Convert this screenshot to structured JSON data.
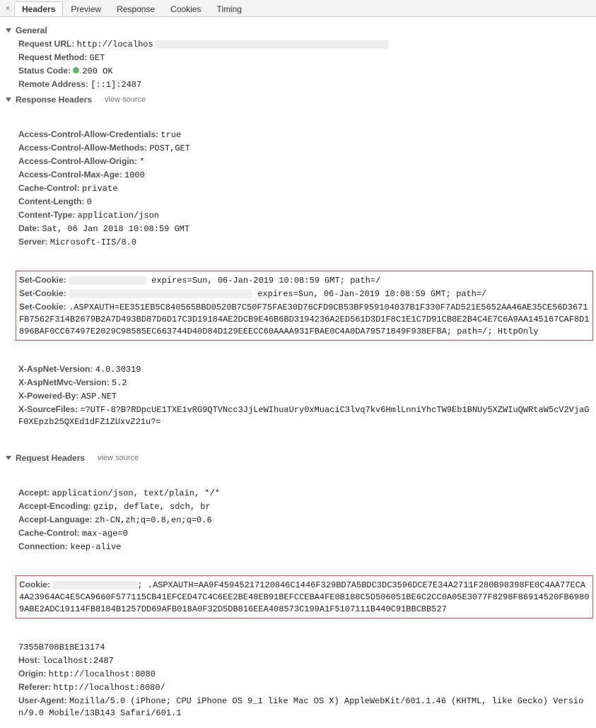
{
  "tabs": {
    "items": [
      "Headers",
      "Preview",
      "Response",
      "Cookies",
      "Timing"
    ],
    "active": 0
  },
  "sections": {
    "general": {
      "title": "General",
      "rows": [
        {
          "key": "Request URL:",
          "val": "http://localhos",
          "blur_after_w": 330
        },
        {
          "key": "Request Method:",
          "val": "GET"
        },
        {
          "key": "Status Code:",
          "val": "200 OK",
          "status_dot": true
        },
        {
          "key": "Remote Address:",
          "val": "[::1]:2487"
        }
      ]
    },
    "response": {
      "title": "Response Headers",
      "view_source": "view source",
      "rows": [
        {
          "key": "Access-Control-Allow-Credentials:",
          "val": "true"
        },
        {
          "key": "Access-Control-Allow-Methods:",
          "val": "POST,GET"
        },
        {
          "key": "Access-Control-Allow-Origin:",
          "val": "*"
        },
        {
          "key": "Access-Control-Max-Age:",
          "val": "1000"
        },
        {
          "key": "Cache-Control:",
          "val": "private"
        },
        {
          "key": "Content-Length:",
          "val": "0"
        },
        {
          "key": "Content-Type:",
          "val": "application/json"
        },
        {
          "key": "Date:",
          "val": "Sat, 06 Jan 2018 10:08:59 GMT"
        },
        {
          "key": "Server:",
          "val": "Microsoft-IIS/8.0"
        }
      ],
      "red_rows": [
        {
          "key": "Set-Cookie:",
          "pre_blur_w": 110,
          "val": " expires=Sun, 06-Jan-2019 10:08:59 GMT; path=/"
        },
        {
          "key": "Set-Cookie:",
          "pre_blur_w": 260,
          "val": " expires=Sun, 06-Jan-2019 10:08:59 GMT; path=/"
        },
        {
          "key": "Set-Cookie:",
          "val": ".ASPXAUTH=EE351EB5C840565BBD0520B7C50F75FAE30D76CFD9CB53BF959104037B1F330F7AD521E5652AA46AE35CE56D3671FB7562F314B2679B2A7D493BD87D6D17C3D19184AE2DCB9E46B6BD3194236A2ED561D3D1F8C1E1C7D91CB8E2B4C4E7C6A9AA145167CAF8D1896BAF0CC67497E2029C98585EC663744D40D84D129EEECC60AAAA931FBAE0C4A0DA79571849F938EFBA; path=/; HttpOnly"
        }
      ],
      "rows_after": [
        {
          "key": "X-AspNet-Version:",
          "val": "4.0.30319"
        },
        {
          "key": "X-AspNetMvc-Version:",
          "val": "5.2"
        },
        {
          "key": "X-Powered-By:",
          "val": "ASP.NET"
        },
        {
          "key": "X-SourceFiles:",
          "val": "=?UTF-8?B?RDpcUE1TXE1vRG9QTVNcc3JjLeWIhuaUry0xMuaciC3lvq7kv6HmlLnniYhcTW9Eb1BNUy5XZWIuQWRtaW5cV2VjaGF0XEpzb25QXEd1dFZ1ZUxvZ21u?="
        }
      ]
    },
    "request": {
      "title": "Request Headers",
      "view_source": "view source",
      "rows": [
        {
          "key": "Accept:",
          "val": "application/json, text/plain, */*"
        },
        {
          "key": "Accept-Encoding:",
          "val": "gzip, deflate, sdch, br"
        },
        {
          "key": "Accept-Language:",
          "val": "zh-CN,zh;q=0.8,en;q=0.6"
        },
        {
          "key": "Cache-Control:",
          "val": "max-age=0"
        },
        {
          "key": "Connection:",
          "val": "keep-alive"
        }
      ],
      "red_rows": [
        {
          "key": "Cookie:",
          "segments": [
            {
              "blur_w": 120
            },
            {
              "text": "; .ASPXAUTH=AA9F45945217120846C1446F329BD7A5BDC3DC3596DCE7E34A2711F280B98398FE0C4AA77ECA4A23964AC4E5CA9660F577115CB41EFCED47C4C6EE2BE48EB91BEFCCEBA4FE0B188C5D506051BE6C2CC0A05E3077F8298F86914520FB69809ABE2ADC19114FB8184B1257DD69AFB018A0F32D5DB816EEA408573C199A1F5107111B440C91BBCBB527"
            }
          ]
        }
      ],
      "rows_after": [
        {
          "raw": true,
          "val": "7355B708B18E13174"
        },
        {
          "key": "Host:",
          "val": "localhost:2487"
        },
        {
          "key": "Origin:",
          "val": "http://localhost:8080"
        },
        {
          "key": "Referer:",
          "val": "http://localhost:8080/"
        },
        {
          "key": "User-Agent:",
          "val": "Mozilla/5.0 (iPhone; CPU iPhone OS 9_1 like Mac OS X) AppleWebKit/601.1.46 (KHTML, like Gecko) Version/9.0 Mobile/13B143 Safari/601.1"
        }
      ]
    }
  }
}
